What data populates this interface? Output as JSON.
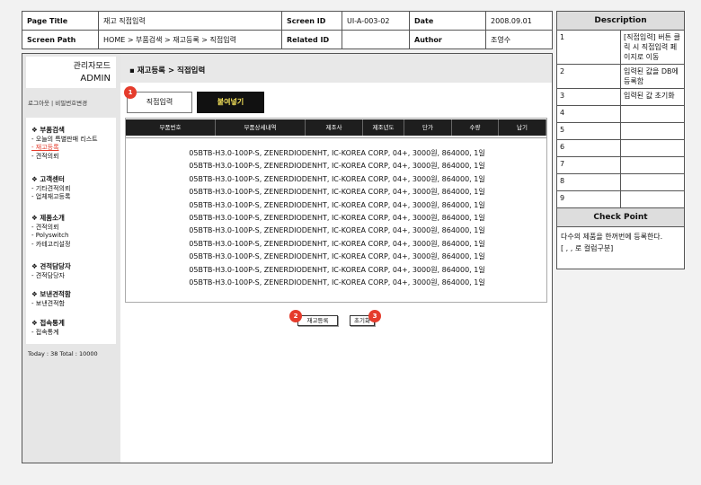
{
  "spec": {
    "page_title_label": "Page Title",
    "page_title": "재고 직접입력",
    "screen_id_label": "Screen ID",
    "screen_id": "UI-A-003-02",
    "date_label": "Date",
    "date": "2008.09.01",
    "screen_path_label": "Screen Path",
    "screen_path": "HOME > 부품검색 > 재고등록 > 직접입력",
    "related_id_label": "Related ID",
    "related_id": "",
    "author_label": "Author",
    "author": "조영수"
  },
  "description": {
    "title": "Description",
    "items": [
      {
        "num": "1",
        "text": "[직접입력] 버튼 클릭 시 직접입력 페이지로 이동"
      },
      {
        "num": "2",
        "text": "입력된 값을 DB에 등록함"
      },
      {
        "num": "3",
        "text": "입력된 값 초기화"
      },
      {
        "num": "4",
        "text": ""
      },
      {
        "num": "5",
        "text": ""
      },
      {
        "num": "6",
        "text": ""
      },
      {
        "num": "7",
        "text": ""
      },
      {
        "num": "8",
        "text": ""
      },
      {
        "num": "9",
        "text": ""
      }
    ],
    "checkpoint_title": "Check Point",
    "checkpoint_line1": "다수의 제품을 한꺼번에 등록한다.",
    "checkpoint_line2": "[ , , 로 컬럼구분]"
  },
  "admin": {
    "mode": "관리자모드",
    "name": "ADMIN"
  },
  "login_links": "로그아웃  |  비밀번호변경",
  "menu": [
    {
      "title": "❖ 부품검색",
      "items": [
        "- 오늘의 특별판매 리스트",
        "- 재고등록",
        "- 견적의뢰"
      ]
    },
    {
      "title": "❖ 고객센터",
      "items": [
        "- 기타견적의뢰",
        "- 업체재고등록"
      ]
    },
    {
      "title": "❖ 제품소개",
      "items": [
        "- 견적의뢰",
        "- Polyswitch",
        "- 카테고리설정"
      ]
    },
    {
      "title": "❖ 견적담당자",
      "items": [
        "- 견적담당자"
      ]
    },
    {
      "title": "❖ 보낸견적함",
      "items": [
        "- 보낸견적함"
      ]
    },
    {
      "title": "❖ 접속통계",
      "items": [
        "- 접속통계"
      ]
    }
  ],
  "stats": "Today : 38   Total : 10000",
  "breadcrumb": "▪ 재고등록 > 직접입력",
  "buttons": {
    "direct_input": "직접입력",
    "paste": "붙여넣기",
    "register": "재고등록",
    "reset": "초기화"
  },
  "badges": [
    "1",
    "2",
    "3"
  ],
  "table": {
    "columns": [
      "부품번호",
      "부품상세내역",
      "제조사",
      "제조년도",
      "단가",
      "수량",
      "납기"
    ],
    "rows": [
      "05BTB-H3.0-100P-S, ZENERDIODENHT, IC-KOREA CORP, 04+, 3000원, 864000, 1일",
      "05BTB-H3.0-100P-S, ZENERDIODENHT, IC-KOREA CORP, 04+, 3000원, 864000, 1일",
      "05BTB-H3.0-100P-S, ZENERDIODENHT, IC-KOREA CORP, 04+, 3000원, 864000, 1일",
      "05BTB-H3.0-100P-S, ZENERDIODENHT, IC-KOREA CORP, 04+, 3000원, 864000, 1일",
      "05BTB-H3.0-100P-S, ZENERDIODENHT, IC-KOREA CORP, 04+, 3000원, 864000, 1일",
      "05BTB-H3.0-100P-S, ZENERDIODENHT, IC-KOREA CORP, 04+, 3000원, 864000, 1일",
      "05BTB-H3.0-100P-S, ZENERDIODENHT, IC-KOREA CORP, 04+, 3000원, 864000, 1일",
      "05BTB-H3.0-100P-S, ZENERDIODENHT, IC-KOREA CORP, 04+, 3000원, 864000, 1일",
      "05BTB-H3.0-100P-S, ZENERDIODENHT, IC-KOREA CORP, 04+, 3000원, 864000, 1일",
      "05BTB-H3.0-100P-S, ZENERDIODENHT, IC-KOREA CORP, 04+, 3000원, 864000, 1일",
      "05BTB-H3.0-100P-S, ZENERDIODENHT, IC-KOREA CORP, 04+, 3000원, 864000, 1일"
    ]
  },
  "colors": {
    "accent_red": "#e53c2c",
    "paste_text": "#f5e25a",
    "header_dark": "#1e1e1e"
  }
}
